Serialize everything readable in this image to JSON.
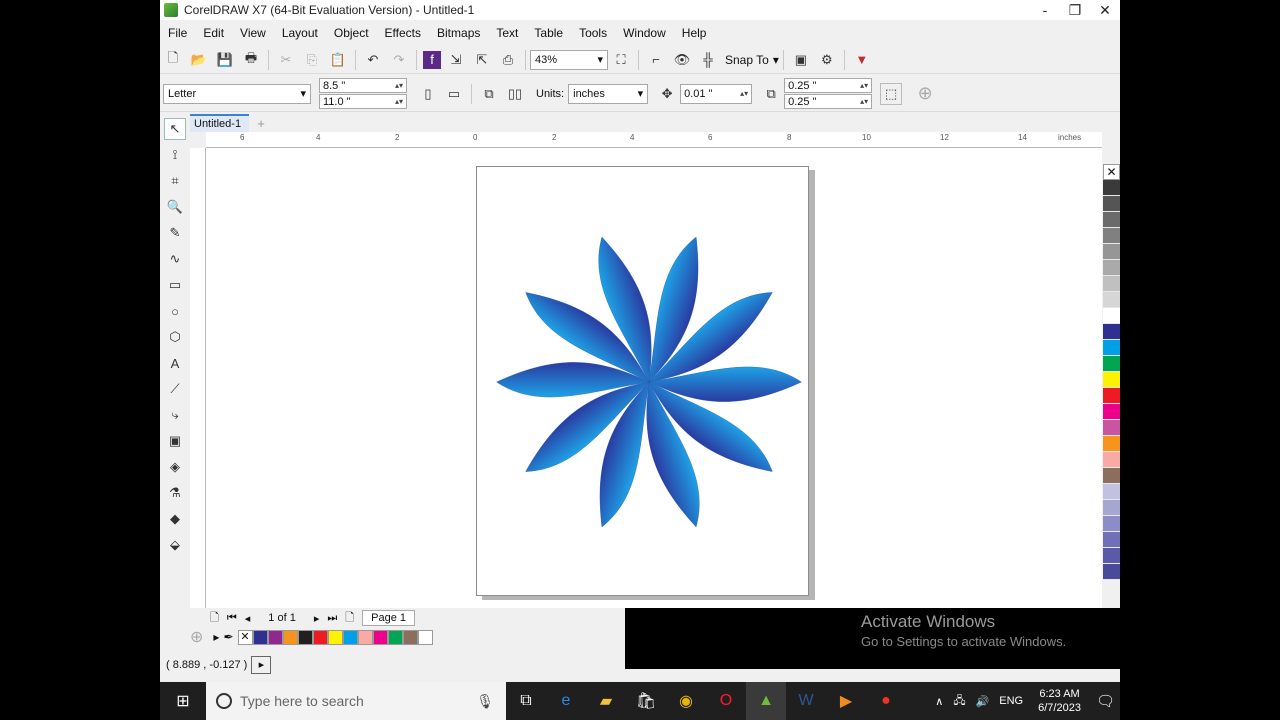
{
  "window": {
    "title": "CorelDRAW X7 (64-Bit Evaluation Version) - Untitled-1",
    "controls": [
      "-",
      "❐",
      "✕"
    ]
  },
  "menu": [
    "File",
    "Edit",
    "View",
    "Layout",
    "Object",
    "Effects",
    "Bitmaps",
    "Text",
    "Table",
    "Tools",
    "Window",
    "Help"
  ],
  "toolbar": {
    "zoom": "43%",
    "snap_to": "Snap To"
  },
  "property_bar": {
    "paper": "Letter",
    "width": "8.5 \"",
    "height": "11.0 \"",
    "units_label": "Units:",
    "units": "inches",
    "nudge": "0.01 \"",
    "dup_x": "0.25 \"",
    "dup_y": "0.25 \""
  },
  "doc_tab": "Untitled-1",
  "ruler": {
    "h_ticks": [
      "6",
      "4",
      "2",
      "0",
      "2",
      "4",
      "6",
      "8",
      "10",
      "12",
      "14"
    ],
    "unit": "inches"
  },
  "page_nav": {
    "count": "1 of 1",
    "tab": "Page 1"
  },
  "status": {
    "coords": "( 8.889 , -0.127 )"
  },
  "activation": {
    "title": "Activate Windows",
    "subtitle": "Go to Settings to activate Windows."
  },
  "taskbar": {
    "search_placeholder": "Type here to search",
    "language": "ENG",
    "time": "6:23 AM",
    "date": "6/7/2023"
  },
  "colors": {
    "flower_light": "#1ea2e6",
    "flower_dark": "#2a3aa0",
    "palette": [
      "#3a3a3a",
      "#555555",
      "#6b6b6b",
      "#808080",
      "#969696",
      "#aaaaaa",
      "#c0c0c0",
      "#d6d6d6",
      "#ffffff",
      "#2e3192",
      "#00a0e9",
      "#00a651",
      "#fff200",
      "#ed1c24",
      "#ec008c",
      "#c8559e",
      "#f7941d",
      "#f9aaa5",
      "#8b6e5e",
      "#c2c2e0",
      "#a6a6d2",
      "#8c8cc8",
      "#7070b8",
      "#5a5aa8",
      "#4a4a9a"
    ],
    "doc_palette": [
      "#2e3192",
      "#92278f",
      "#f7941d",
      "#231f20",
      "#ed1c24",
      "#fff200",
      "#00a0e9",
      "#f9aaa5",
      "#ec008c",
      "#00a651",
      "#8b6e5e",
      "#ffffff"
    ]
  }
}
